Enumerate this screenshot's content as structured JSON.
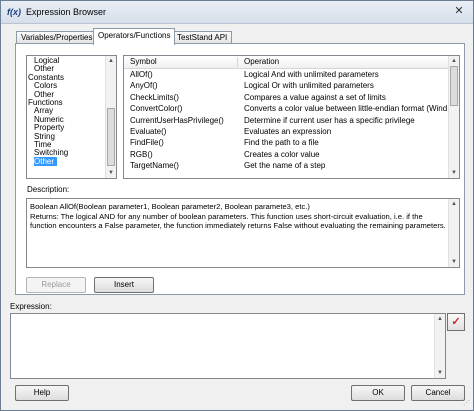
{
  "window": {
    "title": "Expression Browser",
    "app_icon_text": "f(x)",
    "close_glyph": "✕"
  },
  "tabs": [
    {
      "label": "Variables/Properties",
      "active": false
    },
    {
      "label": "Operators/Functions",
      "active": true
    },
    {
      "label": "TestStand API",
      "active": false
    }
  ],
  "category_tree": {
    "items": [
      {
        "label": "Logical",
        "indent": 1,
        "selected": false
      },
      {
        "label": "Other",
        "indent": 1,
        "selected": false
      },
      {
        "label": "Constants",
        "indent": 0,
        "selected": false
      },
      {
        "label": "Colors",
        "indent": 1,
        "selected": false
      },
      {
        "label": "Other",
        "indent": 1,
        "selected": false
      },
      {
        "label": "Functions",
        "indent": 0,
        "selected": false
      },
      {
        "label": "Array",
        "indent": 1,
        "selected": false
      },
      {
        "label": "Numeric",
        "indent": 1,
        "selected": false
      },
      {
        "label": "Property",
        "indent": 1,
        "selected": false
      },
      {
        "label": "String",
        "indent": 1,
        "selected": false
      },
      {
        "label": "Time",
        "indent": 1,
        "selected": false
      },
      {
        "label": "Switching",
        "indent": 1,
        "selected": false
      },
      {
        "label": "Other",
        "indent": 1,
        "selected": true
      }
    ]
  },
  "operations_list": {
    "columns": {
      "symbol": "Symbol",
      "operation": "Operation"
    },
    "rows": [
      {
        "symbol": "AllOf()",
        "operation": "Logical And with unlimited parameters"
      },
      {
        "symbol": "AnyOf()",
        "operation": "Logical Or with unlimited parameters"
      },
      {
        "symbol": "CheckLimits()",
        "operation": "Compares a value against a set of limits"
      },
      {
        "symbol": "ConvertColor()",
        "operation": "Converts a color value between little-endian format (Wind..."
      },
      {
        "symbol": "CurrentUserHasPrivilege()",
        "operation": "Determine if current user has a specific privilege"
      },
      {
        "symbol": "Evaluate()",
        "operation": "Evaluates an expression"
      },
      {
        "symbol": "FindFile()",
        "operation": "Find the path to a file"
      },
      {
        "symbol": "RGB()",
        "operation": "Creates a color value"
      },
      {
        "symbol": "TargetName()",
        "operation": "Get the name of a step"
      }
    ]
  },
  "description": {
    "label": "Description:",
    "text": "Boolean AllOf(Boolean parameter1, Boolean parameter2, Boolean paramete3, etc.)\nReturns: The logical AND for any number of boolean parameters. This function uses short-circuit evaluation, i.e. if the function encounters a False parameter, the function immediately returns False without evaluating the remaining parameters."
  },
  "actions": {
    "replace_label": "Replace",
    "insert_label": "Insert"
  },
  "expression": {
    "label": "Expression:",
    "value": "",
    "check_glyph": "✓"
  },
  "footer": {
    "help_label": "Help",
    "ok_label": "OK",
    "cancel_label": "Cancel"
  }
}
